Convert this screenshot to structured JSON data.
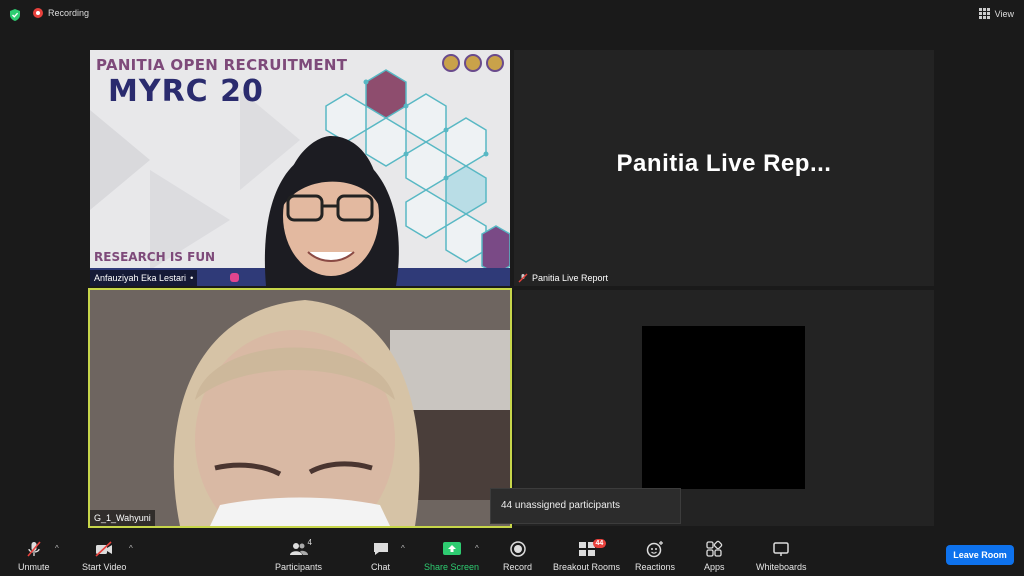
{
  "top": {
    "recording_label": "Recording",
    "view_label": "View"
  },
  "tiles": {
    "speaker1": {
      "name": "Anfauziyah Eka Lestari",
      "poster_line1": "PANITIA OPEN RECRUITMENT",
      "poster_line2": "MYRC 20",
      "poster_tagline": "RESEARCH IS FUN"
    },
    "speaker2": {
      "display_name": "Panitia Live Rep...",
      "name": "Panitia Live Report"
    },
    "speaker3": {
      "name": "G_1_Wahyuni"
    }
  },
  "tooltip": {
    "text": "44 unassigned participants"
  },
  "toolbar": {
    "unmute": "Unmute",
    "start_video": "Start Video",
    "participants": "Participants",
    "participants_count": "4",
    "chat": "Chat",
    "share_screen": "Share Screen",
    "record": "Record",
    "breakout_rooms": "Breakout Rooms",
    "breakout_count": "44",
    "reactions": "Reactions",
    "apps": "Apps",
    "whiteboards": "Whiteboards",
    "leave": "Leave Room"
  },
  "colors": {
    "accent_blue": "#0e72ed",
    "share_green": "#2ecc71",
    "active_speaker_border": "#c7d64a",
    "record_red": "#e8413c"
  }
}
